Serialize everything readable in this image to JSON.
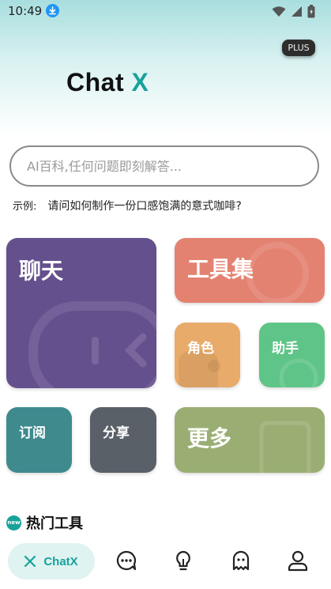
{
  "status_bar": {
    "time": "10:49"
  },
  "header": {
    "plus_badge": "PLUS",
    "brand_main": "Chat ",
    "brand_accent": "X"
  },
  "search": {
    "placeholder": "AI百科,任何问题即刻解答...",
    "value": ""
  },
  "example": {
    "label": "示例:",
    "text": "请问如何制作一份口感饱满的意式咖啡?"
  },
  "tiles": {
    "chat": "聊天",
    "tools": "工具集",
    "role": "角色",
    "helper": "助手",
    "subscribe": "订阅",
    "share": "分享",
    "more": "更多"
  },
  "hot_tools": {
    "badge": "new",
    "title": "热门工具"
  },
  "bottom_nav": {
    "active_label": "ChatX"
  },
  "colors": {
    "accent": "#17a29c",
    "chat": "#65508e",
    "tools": "#e48271",
    "role": "#e8ab6a",
    "helper": "#5fc487",
    "subscribe": "#3e8a8d",
    "share": "#5a6068",
    "more": "#9aae73"
  }
}
